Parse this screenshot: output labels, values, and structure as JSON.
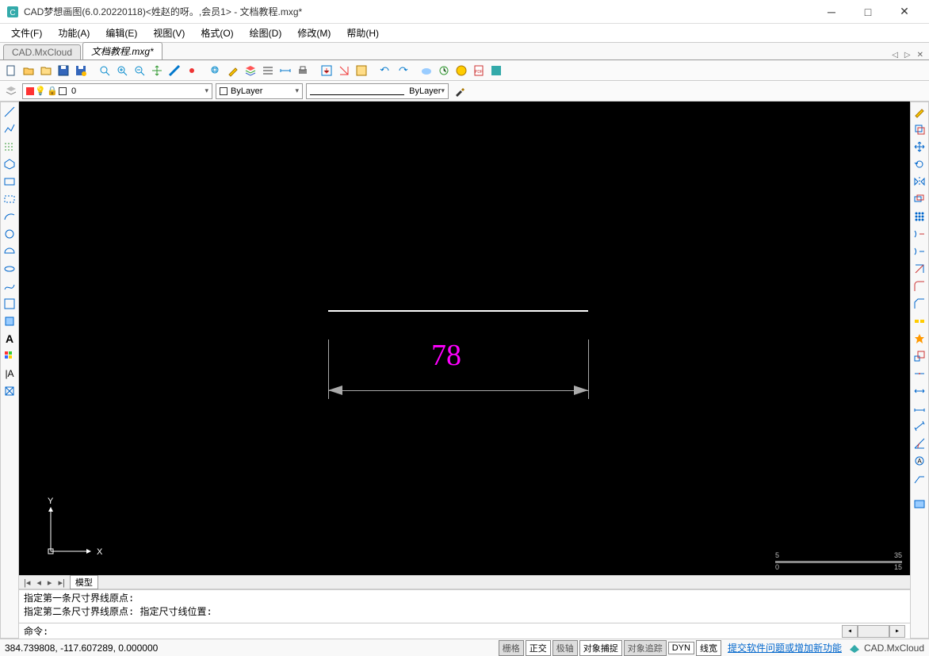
{
  "title": "CAD梦想画图(6.0.20220118)<姓赵的呀。,会员1> - 文档教程.mxg*",
  "menu": [
    "文件(F)",
    "功能(A)",
    "编辑(E)",
    "视图(V)",
    "格式(O)",
    "绘图(D)",
    "修改(M)",
    "帮助(H)"
  ],
  "doc_tabs": [
    {
      "label": "CAD.MxCloud",
      "active": false
    },
    {
      "label": "文档教程.mxg*",
      "active": true
    }
  ],
  "toolbar_icons": [
    "new",
    "open",
    "folder-open",
    "save",
    "save-as",
    "separator",
    "zoom-fit",
    "zoom-in",
    "zoom-out",
    "pan",
    "measure",
    "point",
    "zoom-window",
    "select",
    "pencil",
    "layers",
    "line-weight",
    "dimension",
    "print",
    "export",
    "import",
    "pdf",
    "undo",
    "redo",
    "cloud",
    "sync",
    "help",
    "pdf-export",
    "app"
  ],
  "layer": {
    "current": "0",
    "options": [
      "0"
    ]
  },
  "bylayer_color": "ByLayer",
  "linetype": "ByLayer",
  "left_tools": [
    "line",
    "polyline",
    "hatch",
    "polygon",
    "rect",
    "clip",
    "arc",
    "circle",
    "semicircle",
    "ellipse",
    "spline",
    "rectangle2",
    "region",
    "text-A",
    "grid",
    "text-dim",
    "block"
  ],
  "right_tools": [
    "pencil",
    "copy",
    "move",
    "rotate",
    "mirror",
    "offset",
    "array",
    "clip",
    "extend",
    "trim",
    "extract",
    "fillet",
    "chamfer",
    "break",
    "explode",
    "scale",
    "join",
    "stretch",
    "align",
    "dim-linear",
    "dim-align",
    "dim-angle",
    "sep",
    "leader",
    "blank",
    "screenshot"
  ],
  "model_tabs": [
    "模型"
  ],
  "canvas": {
    "dimension_value": "78",
    "ucs_labels": {
      "x": "X",
      "y": "Y"
    },
    "ruler": {
      "min": "0",
      "mid": "15",
      "mid2": "5",
      "max": "35"
    }
  },
  "cmd_output": [
    "指定第一条尺寸界线原点:",
    "指定第二条尺寸界线原点: 指定尺寸线位置:"
  ],
  "cmd_prompt": "命令:",
  "cmd_value": "",
  "status": {
    "coords": "384.739808,  -117.607289,  0.000000",
    "toggles": [
      {
        "label": "栅格",
        "on": false
      },
      {
        "label": "正交",
        "on": true
      },
      {
        "label": "极轴",
        "on": false
      },
      {
        "label": "对象捕捉",
        "on": true
      },
      {
        "label": "对象追踪",
        "on": false
      },
      {
        "label": "DYN",
        "on": true
      },
      {
        "label": "线宽",
        "on": true
      }
    ],
    "link": "提交软件问题或增加新功能",
    "cloud": "CAD.MxCloud"
  }
}
